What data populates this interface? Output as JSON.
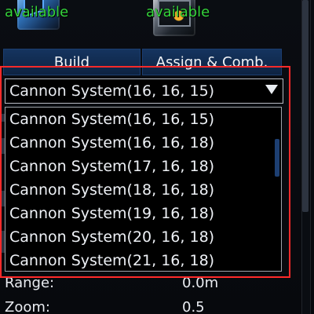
{
  "top_blocks": {
    "left_status": "available",
    "right_status": "available"
  },
  "tabs": {
    "build": "Build",
    "assign_comb": "Assign & Comb."
  },
  "dropdown": {
    "selected": "Cannon System(16, 16, 15)",
    "options": [
      "Cannon System(16, 16, 15)",
      "Cannon System(16, 16, 18)",
      "Cannon System(17, 16, 18)",
      "Cannon System(18, 16, 18)",
      "Cannon System(19, 16, 18)",
      "Cannon System(20, 16, 18)",
      "Cannon System(21, 16, 18)"
    ]
  },
  "stats": {
    "range_label": "Range:",
    "range_value": "0.0m",
    "zoom_label": "Zoom:",
    "zoom_value": "0.5"
  },
  "icons": {
    "left_block": "blue-cannon-block-icon",
    "right_block": "gray-system-block-icon",
    "dropdown_arrow": "triangle-down-icon"
  },
  "colors": {
    "available_text": "#35d53c",
    "tab_blue": "#15345f",
    "highlight_red": "#ff2a2a"
  }
}
